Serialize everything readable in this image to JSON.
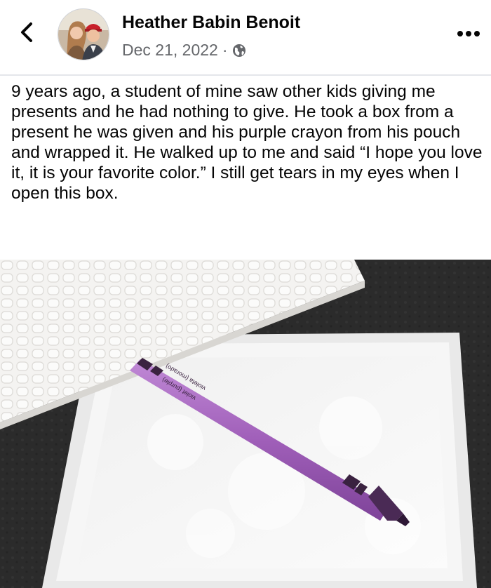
{
  "post": {
    "author": "Heather Babin Benoit",
    "date": "Dec 21, 2022",
    "separator": "·",
    "audience_icon": "globe-icon",
    "text": "9 years ago, a student of mine saw other kids giving me presents and he had nothing to give. He took a box from a present he was given and his purple crayon from his pouch and wrapped it. He walked up to me and said “I hope you love it, it is your favorite color.” I still get tears in my eyes when I open this box."
  },
  "photo": {
    "crayon_label_line1": "violet (purple)",
    "crayon_label_line2": "violeta (morado)"
  },
  "icons": {
    "back": "chevron-left-icon",
    "more": "more-options-icon"
  },
  "colors": {
    "crayon": "#a05fb9",
    "background": "#ffffff",
    "secondary_text": "#65676b"
  }
}
